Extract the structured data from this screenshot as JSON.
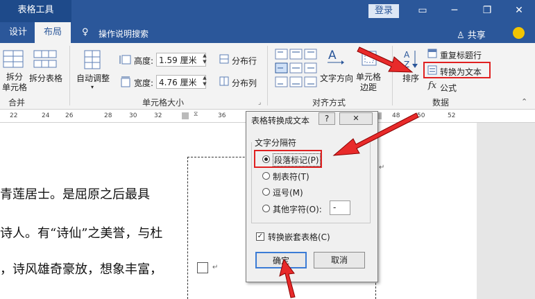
{
  "titlebar": {
    "tool_title": "表格工具",
    "login": "登录"
  },
  "tabs": {
    "design": "设计",
    "layout": "布局",
    "search": "操作说明搜索",
    "share": "共享"
  },
  "ribbon": {
    "merge": {
      "split_cells": "拆分\n单元格",
      "split_table": "拆分表格",
      "group": "合并"
    },
    "cell_size": {
      "autofit": "自动调整",
      "height_label": "高度:",
      "height_value": "1.59 厘米",
      "width_label": "宽度:",
      "width_value": "4.76 厘米",
      "distribute_rows": "分布行",
      "distribute_cols": "分布列",
      "group": "单元格大小"
    },
    "alignment": {
      "text_direction": "文字方向",
      "cell_margins": "单元格\n边距",
      "group": "对齐方式"
    },
    "data": {
      "sort": "排序",
      "repeat_header": "重复标题行",
      "convert_to_text": "转换为文本",
      "formula": "公式",
      "group": "数据"
    }
  },
  "ruler": {
    "ticks": [
      "22",
      "24",
      "26",
      "28",
      "30",
      "32",
      "36",
      "48",
      "50",
      "52"
    ]
  },
  "document": {
    "lines": [
      "青莲居士。是屈原之后最具",
      "诗人。有“诗仙”之美誉，与杜",
      "，诗风雄奇豪放，想象丰富，"
    ]
  },
  "dialog": {
    "title": "表格转换成文本",
    "help": "?",
    "close": "✕",
    "section": "文字分隔符",
    "options": [
      "段落标记(P)",
      "制表符(T)",
      "逗号(M)",
      "其他字符(O):"
    ],
    "other_value": "-",
    "checkbox_label": "转换嵌套表格(C)",
    "ok": "确定",
    "cancel": "取消"
  },
  "colors": {
    "brand": "#2b579a",
    "highlight": "#e02020"
  }
}
